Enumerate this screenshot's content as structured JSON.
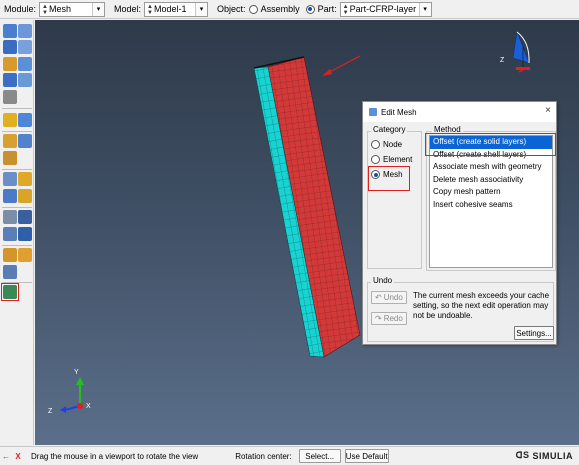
{
  "topbar": {
    "module_label": "Module:",
    "module_value": "Mesh",
    "model_label": "Model:",
    "model_value": "Model-1",
    "object_label": "Object:",
    "assembly_label": "Assembly",
    "part_label": "Part:",
    "part_value": "Part-CFRP-layer"
  },
  "triad": {
    "x": "X",
    "y": "Y",
    "z": "Z"
  },
  "view_cube": {
    "z": "Z"
  },
  "dialog": {
    "title": "Edit Mesh",
    "close": "×",
    "category_label": "Category",
    "categories": [
      {
        "label": "Node",
        "selected": false
      },
      {
        "label": "Element",
        "selected": false
      },
      {
        "label": "Mesh",
        "selected": true
      }
    ],
    "method_label": "Method",
    "methods": [
      {
        "label": "Offset (create solid layers)",
        "selected": true
      },
      {
        "label": "Offset (create shell layers)",
        "selected": false
      },
      {
        "label": "Associate mesh with geometry",
        "selected": false
      },
      {
        "label": "Delete mesh associativity",
        "selected": false
      },
      {
        "label": "Copy mesh pattern",
        "selected": false
      },
      {
        "label": "Insert cohesive seams",
        "selected": false
      }
    ],
    "undo_label": "Undo",
    "undo_button": "Undo",
    "redo_button": "Redo",
    "undo_message": "The current mesh exceeds your cache setting, so the next edit operation may not be undoable.",
    "settings_button": "Settings..."
  },
  "promptbar": {
    "cancel_glyph": "X",
    "prompt_text": "Drag the mouse in a viewport to rotate the view",
    "rotation_center_label": "Rotation center:",
    "select_button": "Select...",
    "use_default_button": "Use Default"
  },
  "brand": {
    "name": "SIMULIA"
  },
  "colors": {
    "mesh_face": "#d23a3a",
    "mesh_side": "#19d2d2",
    "highlight": "#e02020",
    "selection": "#0a64d6"
  }
}
